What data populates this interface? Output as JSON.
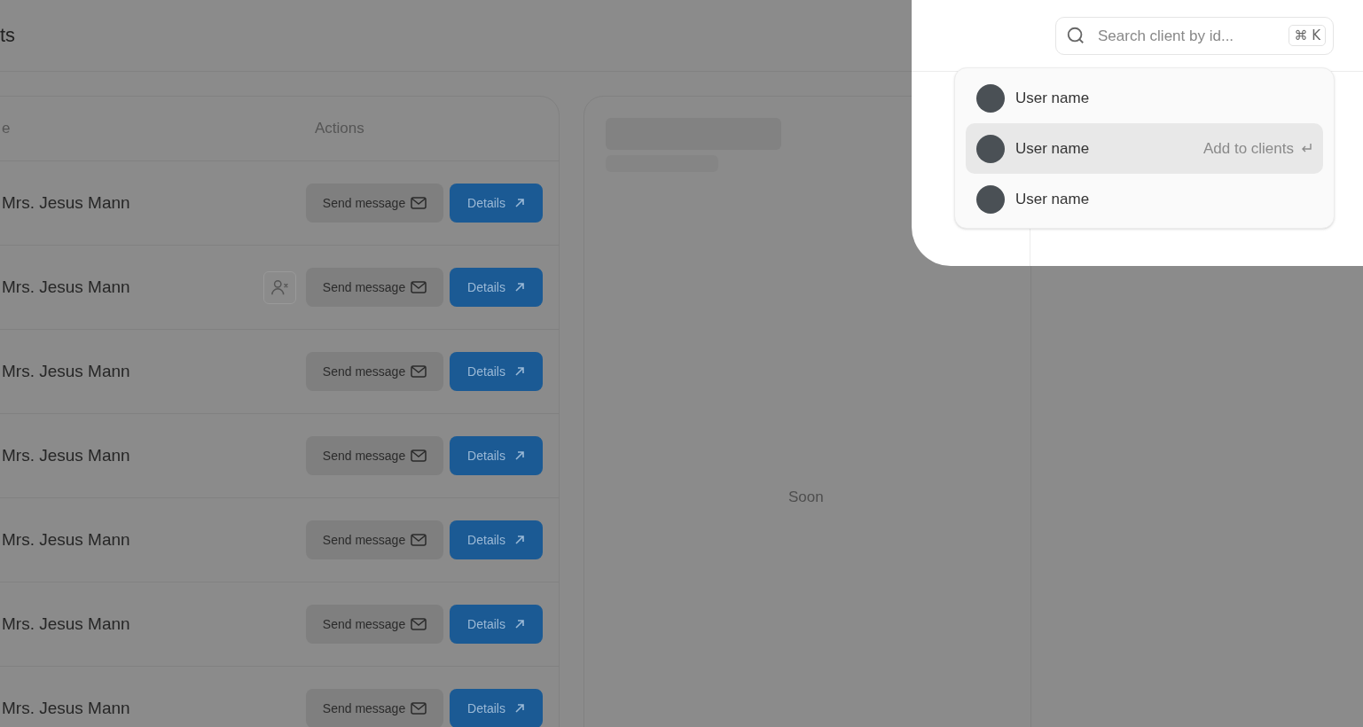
{
  "header": {
    "title": "ts"
  },
  "table": {
    "columns": [
      "e",
      "Actions"
    ],
    "rows": [
      {
        "name": "Mrs. Jesus Mann",
        "remove_button": false,
        "send_label": "Send message",
        "details_label": "Details"
      },
      {
        "name": "Mrs. Jesus Mann",
        "remove_button": true,
        "send_label": "Send message",
        "details_label": "Details"
      },
      {
        "name": "Mrs. Jesus Mann",
        "remove_button": false,
        "send_label": "Send message",
        "details_label": "Details"
      },
      {
        "name": "Mrs. Jesus Mann",
        "remove_button": false,
        "send_label": "Send message",
        "details_label": "Details"
      },
      {
        "name": "Mrs. Jesus Mann",
        "remove_button": false,
        "send_label": "Send message",
        "details_label": "Details"
      },
      {
        "name": "Mrs. Jesus Mann",
        "remove_button": false,
        "send_label": "Send message",
        "details_label": "Details"
      },
      {
        "name": "Mrs. Jesus Mann",
        "remove_button": false,
        "send_label": "Send message",
        "details_label": "Details"
      }
    ]
  },
  "side_panel": {
    "status": "Soon"
  },
  "search": {
    "placeholder": "Search client by id...",
    "shortcut": "⌘ K"
  },
  "results": [
    {
      "name": "User name",
      "selected": false
    },
    {
      "name": "User name",
      "selected": true,
      "action": "Add to clients"
    },
    {
      "name": "User name",
      "selected": false
    }
  ]
}
